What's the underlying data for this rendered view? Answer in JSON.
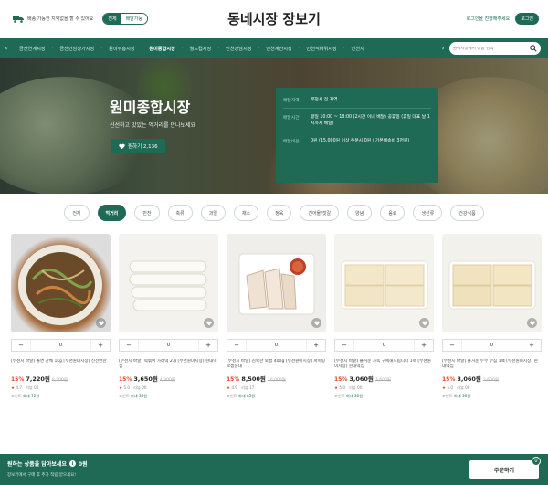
{
  "header": {
    "delivery_text": "배송 가능한 지역없을 할 수 있어요",
    "toggle": [
      "전체",
      "배달가능"
    ],
    "title": "동네시장 장보기",
    "links": [
      "로그인을 진행해주세요"
    ],
    "login_label": "로그인"
  },
  "nav": {
    "items": [
      "금산연계시장",
      "금산인삼상가시장",
      "원미부흥시장",
      "원미종합시장",
      "월드컵시장",
      "인천강남시장",
      "인천계산시장",
      "인천석바위시장",
      "인천지"
    ],
    "active_index": 3,
    "search_placeholder": "원미시장에서 상품 검색"
  },
  "hero": {
    "title": "원미종합시장",
    "subtitle": "신선하고 맛있는 먹거리를 만나보세요",
    "likes": "찜하기 2,136",
    "info": [
      {
        "label": "배달지역",
        "value": "부천시 전 지역"
      },
      {
        "label": "배달시간",
        "value": "평일 10:00 ~ 18:00 (2시간 이내 배달) 공휴일 (휴일 대표 날 1시까지 배달)"
      },
      {
        "label": "배달비용",
        "value": "0원 (15,000원 이상 주문시 0원 / 기본배송비 3천원)"
      }
    ]
  },
  "categories": {
    "items": [
      "전체",
      "먹거리",
      "반찬",
      "축류",
      "과일",
      "채소",
      "정육",
      "건어물/젓갈",
      "양념",
      "음료",
      "생선류",
      "건강식품"
    ],
    "active_index": 1
  },
  "products": [
    {
      "name": "[부천시 바달] 쫄면 간체 1kg [부천원미시장] 신선반찬",
      "discount": "15%",
      "price": "7,220원",
      "original": "8,500원",
      "rating": "4.7",
      "reviews": "리뷰 00",
      "point_label": "포인트",
      "point": "최대 72원"
    },
    {
      "name": "[부천시 바달] 떡볶이 가래떡 2개 [부천원미시장] 현대떡집",
      "discount": "15%",
      "price": "3,650원",
      "original": "4,300원",
      "rating": "5.0",
      "reviews": "리뷰 00",
      "point_label": "포인트",
      "point": "최대 36원"
    },
    {
      "name": "[부천시 바달] 김북한 보쌈 400g [부천원미시장] 파이팅보쌈순대",
      "discount": "15%",
      "price": "8,500원",
      "original": "10,000원",
      "rating": "4.9",
      "reviews": "리뷰 17",
      "point_label": "포인트",
      "point": "최대 85원"
    },
    {
      "name": "[부천시 바달] 즐거운 가족 구매해드립니다 1팩 [부천원미시장] 현대떡집",
      "discount": "15%",
      "price": "3,060원",
      "original": "3,600원",
      "rating": "5.0",
      "reviews": "리뷰 00",
      "point_label": "포인트",
      "point": "최대 30원"
    },
    {
      "name": "[부천시 바달] 즐거운 두부 부침 1팩 [부천원미시장] 현대떡집",
      "discount": "15%",
      "price": "3,060원",
      "original": "3,600원",
      "rating": "5.0",
      "reviews": "리뷰 00",
      "point_label": "포인트",
      "point": "최대 30원"
    }
  ],
  "stepper": {
    "minus": "−",
    "value": "0",
    "plus": "+"
  },
  "bottom": {
    "main": "원하는 상품을 담아보세요",
    "count": "0원",
    "sub": "장보기에서 구매 후 추가 적립 받으세요!",
    "order_label": "주문하기",
    "cart_count": "0"
  },
  "colors": {
    "brand": "#1e6a55",
    "discount": "#e2452b"
  }
}
